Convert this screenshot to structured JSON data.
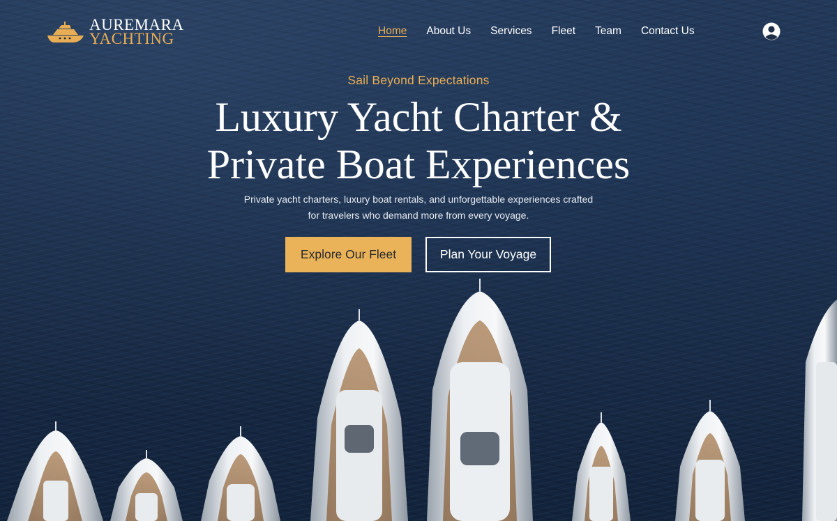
{
  "brand": {
    "line1": "AUREMARA",
    "line2": "YACHTING",
    "icon": "yacht-icon",
    "accent_color": "#e9ae55"
  },
  "nav": {
    "items": [
      {
        "label": "Home",
        "active": true
      },
      {
        "label": "About Us",
        "active": false
      },
      {
        "label": "Services",
        "active": false
      },
      {
        "label": "Fleet",
        "active": false
      },
      {
        "label": "Team",
        "active": false
      },
      {
        "label": "Contact Us",
        "active": false
      }
    ],
    "login_icon": "user-avatar-icon"
  },
  "hero": {
    "tagline": "Sail Beyond Expectations",
    "headline_line1": "Luxury Yacht Charter &",
    "headline_line2": "Private Boat Experiences",
    "subtext_line1": "Private yacht charters, luxury boat rentals, and unforgettable experiences crafted",
    "subtext_line2": "for travelers who demand more from every voyage.",
    "primary_button": "Explore Our Fleet",
    "secondary_button": "Plan Your Voyage",
    "primary_color": "#eab35a",
    "background_image": "aerial-view-of-yachts-on-dark-sea"
  }
}
